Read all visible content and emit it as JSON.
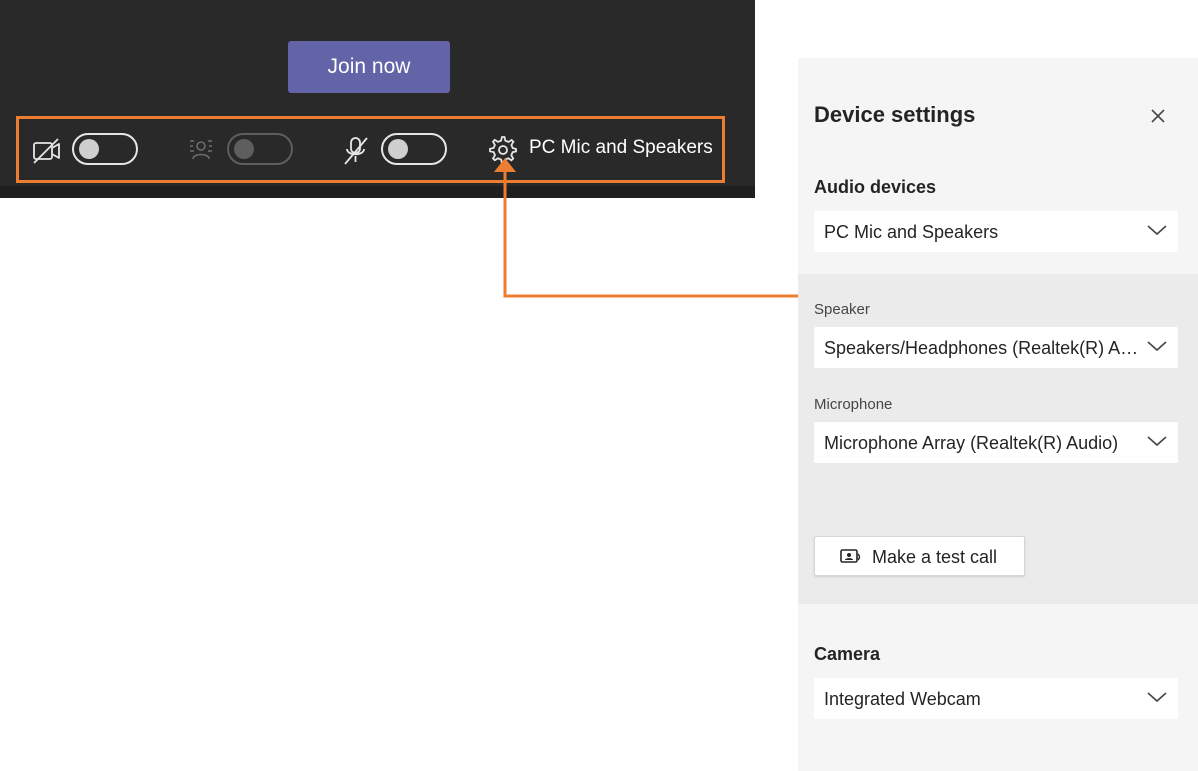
{
  "prejoin": {
    "join_label": "Join now",
    "toolbar": {
      "camera_icon": "camera-off-icon",
      "blur_icon": "background-blur-icon",
      "mic_icon": "mic-off-icon",
      "settings_icon": "gear-icon",
      "device_label": "PC Mic and Speakers"
    }
  },
  "device_settings": {
    "title": "Device settings",
    "close_icon": "close-icon",
    "audio_devices_title": "Audio devices",
    "audio_device_value": "PC Mic and Speakers",
    "speaker_label": "Speaker",
    "speaker_value": "Speakers/Headphones (Realtek(R) Audio)",
    "microphone_label": "Microphone",
    "microphone_value": "Microphone Array (Realtek(R) Audio)",
    "test_call_label": "Make a test call",
    "camera_title": "Camera",
    "camera_value": "Integrated Webcam"
  },
  "colors": {
    "accent": "#6264a7",
    "callout": "#ed7d31",
    "dark_bg": "#292929",
    "panel_bg": "#f5f5f5"
  }
}
